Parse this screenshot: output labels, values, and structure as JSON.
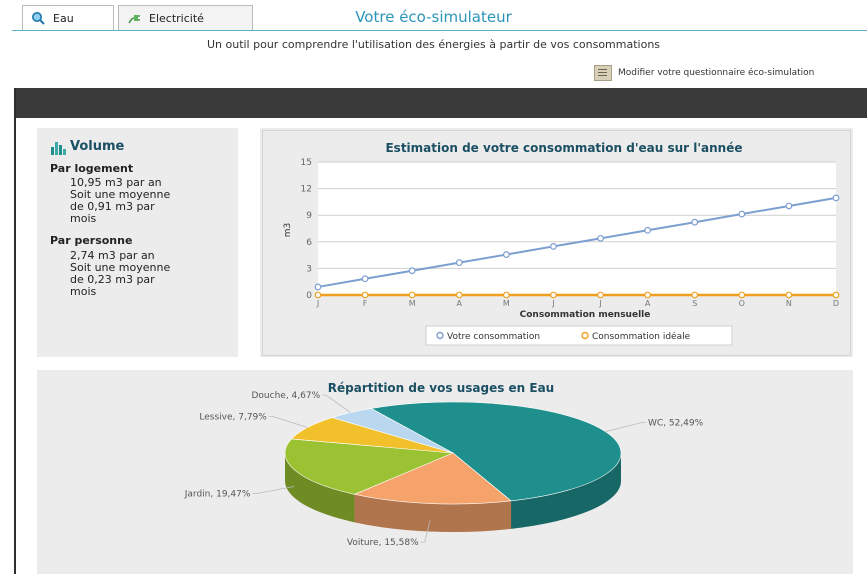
{
  "header": {
    "title": "Votre éco-simulateur",
    "subtitle": "Un outil pour comprendre l'utilisation des énergies à partir de vos consommations",
    "modify_link": "Modifier votre questionnaire éco-simulation"
  },
  "tabs": [
    {
      "label": "Eau",
      "active": true,
      "icon": "water-drop-search-icon"
    },
    {
      "label": "Electricité",
      "active": false,
      "icon": "electric-plug-icon"
    }
  ],
  "volume": {
    "title": "Volume",
    "icon": "bar-chart-icon",
    "per_home": {
      "heading": "Par logement",
      "lines": [
        "10,95 m3 par an",
        "Soit une moyenne",
        "de 0,91 m3 par",
        "mois"
      ]
    },
    "per_person": {
      "heading": "Par personne",
      "lines": [
        "2,74 m3 par an",
        "Soit une moyenne",
        "de 0,23 m3 par",
        "mois"
      ]
    }
  },
  "colors": {
    "accent": "#2b95b8",
    "line_series": "#7d9fd0",
    "ideal_series": "#f0a020",
    "wc": "#1f8f8d",
    "voiture": "#f5a36a",
    "jardin": "#9ac232",
    "lessive": "#f1c02b",
    "douche": "#b9d7ee"
  },
  "chart_data": [
    {
      "type": "line",
      "title": "Estimation de votre consommation d'eau sur l'année",
      "xlabel": "Consommation mensuelle",
      "ylabel": "m3",
      "categories": [
        "J",
        "F",
        "M",
        "A",
        "M",
        "J",
        "J",
        "A",
        "S",
        "O",
        "N",
        "D"
      ],
      "ylim": [
        0,
        15
      ],
      "yticks": [
        0,
        3,
        6,
        9,
        12,
        15
      ],
      "grid": true,
      "legend_position": "bottom",
      "series": [
        {
          "name": "Votre consommation",
          "values": [
            0.91,
            1.83,
            2.74,
            3.65,
            4.56,
            5.48,
            6.39,
            7.3,
            8.21,
            9.13,
            10.04,
            10.95
          ]
        },
        {
          "name": "Consommation idéale",
          "values": [
            0,
            0,
            0,
            0,
            0,
            0,
            0,
            0,
            0,
            0,
            0,
            0
          ]
        }
      ]
    },
    {
      "type": "pie",
      "title": "Répartition de vos usages en Eau",
      "slices": [
        {
          "name": "WC",
          "value": 52.49,
          "label": "WC, 52,49%"
        },
        {
          "name": "Voiture",
          "value": 15.58,
          "label": "Voiture, 15,58%"
        },
        {
          "name": "Jardin",
          "value": 19.47,
          "label": "Jardin, 19,47%"
        },
        {
          "name": "Lessive",
          "value": 7.79,
          "label": "Lessive, 7,79%"
        },
        {
          "name": "Douche",
          "value": 4.67,
          "label": "Douche, 4,67%"
        }
      ]
    }
  ]
}
